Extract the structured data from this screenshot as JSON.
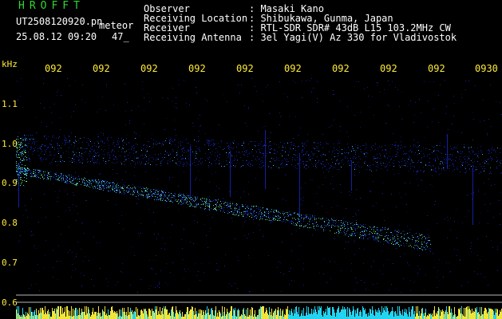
{
  "header": {
    "brand": "HROFFT",
    "file_name": "UT2508120920.pn",
    "type_label": "meteor",
    "datetime": "25.08.12 09:20",
    "count": "47_",
    "fields": [
      {
        "label": "Observer",
        "value": ": Masaki Kano"
      },
      {
        "label": "Receiving Location",
        "value": ": Shibukawa, Gunma, Japan"
      },
      {
        "label": "Receiver",
        "value": ": RTL-SDR SDR# 43dB L15 103.2MHz CW"
      },
      {
        "label": "Receiving Antenna",
        "value": ": 3el Yagi(V) Az 330 for Vladivostok"
      }
    ]
  },
  "time_axis": {
    "labels": [
      "092",
      "092",
      "092",
      "092",
      "092",
      "092",
      "092",
      "092",
      "092",
      "0930"
    ]
  },
  "freq_axis": {
    "unit": "kHz",
    "ticks": [
      "1.1",
      "1.0",
      "0.9",
      "0.8",
      "0.7",
      "0.6"
    ]
  },
  "colors": {
    "background": "#000000",
    "text": "#ffffff",
    "axis_labels": "#ffeb3b",
    "brand": "#33d633",
    "signal_low": "#1a2bd6",
    "signal_mid": "#3fd0ff",
    "signal_high": "#7dff6a",
    "noise_bar_yellow": "#f2e53a",
    "noise_bar_cyan": "#23d4f0"
  }
}
